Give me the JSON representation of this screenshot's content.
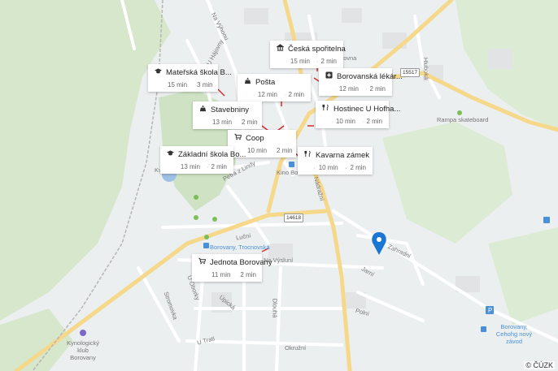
{
  "cards": [
    {
      "id": "ceska-sporitelna",
      "name": "Česká spořitelna",
      "icon": "bank-icon",
      "walk": "15 min",
      "drive": "2 min"
    },
    {
      "id": "materska-skola",
      "name": "Mateřská škola B...",
      "icon": "school-icon",
      "walk": "15 min",
      "drive": "3 min"
    },
    {
      "id": "posta",
      "name": "Pošta",
      "icon": "building-icon",
      "walk": "12 min",
      "drive": "2 min"
    },
    {
      "id": "borovanska-lekarna",
      "name": "Borovanská lékár...",
      "icon": "pharmacy-icon",
      "walk": "12 min",
      "drive": "2 min"
    },
    {
      "id": "stavebniny",
      "name": "Stavebniny",
      "icon": "building-icon",
      "walk": "13 min",
      "drive": "2 min"
    },
    {
      "id": "hostinec",
      "name": "Hostinec U Hofha...",
      "icon": "restaurant-icon",
      "walk": "10 min",
      "drive": "2 min"
    },
    {
      "id": "coop",
      "name": "Coop",
      "icon": "cart-icon",
      "walk": "10 min",
      "drive": "2 min"
    },
    {
      "id": "zakladni-skola",
      "name": "Základní škola Bo...",
      "icon": "school-icon",
      "walk": "13 min",
      "drive": "2 min"
    },
    {
      "id": "kavarna",
      "name": "Kavarna zámek",
      "icon": "restaurant-icon",
      "walk": "10 min",
      "drive": "2 min"
    },
    {
      "id": "jednota",
      "name": "Jednota Borovany",
      "icon": "cart-icon",
      "walk": "11 min",
      "drive": "2 min"
    }
  ],
  "map_labels": {
    "u_hajovny": "U Hájovny",
    "na_vyhonu": "Na Výhonu",
    "hluboka": "Hluboká",
    "rampa": "Rampa skateboard",
    "nadrazni": "Nádražní",
    "petra_z_lindy": "Petra z Lindy",
    "kino": "Kino Boro...",
    "lucni": "Luční",
    "borovany_trocnovska": "Borovany, Trocnovská",
    "na_vysluni": "Na Výsluní",
    "u_oborky": "U Oborky",
    "stromovka": "Stromovka",
    "upicka": "Úpická",
    "dlouha": "Dlouhá",
    "u_trati": "U Trati",
    "okruzni": "Okružní",
    "polni": "Polní",
    "jarni": "Jarní",
    "zahradni": "Zahradní",
    "kynologicky_klub": "Kynologický klub Borovany",
    "borovany_cehohg": "Borovany, Cehohg nový závod",
    "sporitelna_small": "tovna",
    "mapa_skolky": "Kv"
  },
  "road_numbers": {
    "r15517": "15517",
    "r14618": "14618"
  },
  "copyright": "© ČÚZK",
  "colors": {
    "pin": "#1976d2",
    "arrow": "#d32f2f",
    "park": "#cfe3c4",
    "road_major": "#f5d88a",
    "road_minor": "#ffffff"
  }
}
